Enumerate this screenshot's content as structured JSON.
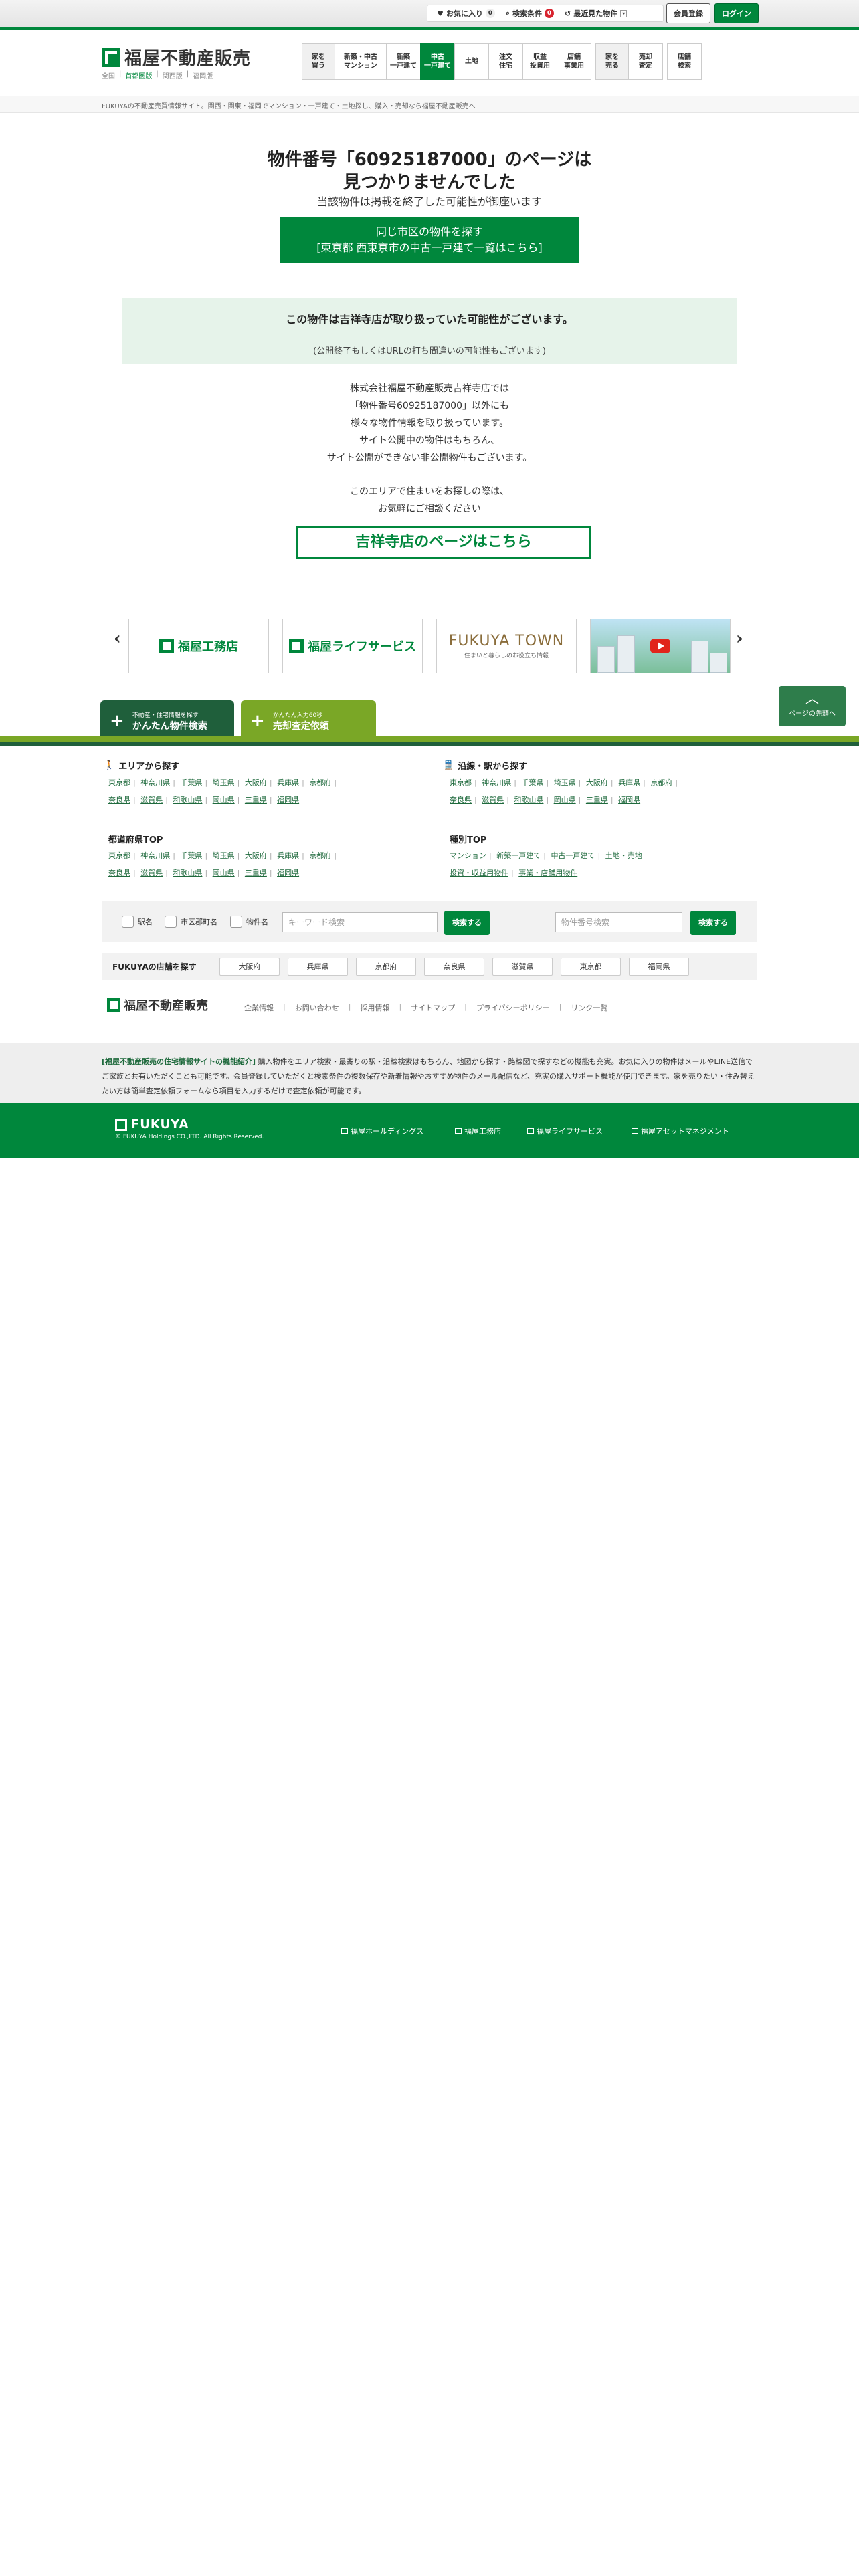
{
  "topbar": {
    "favorites_label": "お気に入り",
    "favorites_count": "0",
    "search_conditions_label": "検索条件",
    "search_conditions_count": "0",
    "recent_label": "最近見た物件",
    "register_label": "会員登録",
    "login_label": "ログイン"
  },
  "header": {
    "logo_text": "福屋不動産販売",
    "regions": [
      "全国",
      "首都圏版",
      "関西版",
      "福岡版"
    ],
    "nav": [
      {
        "label": "家を\n買う"
      },
      {
        "label": "新築・中古\nマンション"
      },
      {
        "label": "新築\n一戸建て"
      },
      {
        "label": "中古\n一戸建て"
      },
      {
        "label": "土地"
      },
      {
        "label": "注文\n住宅"
      },
      {
        "label": "収益\n投資用"
      },
      {
        "label": "店舗\n事業用"
      },
      {
        "label": "家を\n売る"
      },
      {
        "label": "売却\n査定"
      },
      {
        "label": "店舗\n検索"
      }
    ]
  },
  "breadcrumb": "FUKUYAの不動産売買情報サイト。関西・関東・福岡でマンション・一戸建て・土地探し、購入・売却なら福屋不動産販売へ",
  "main": {
    "title_line1": "物件番号「60925187000」のページは",
    "title_line2": "見つかりませんでした",
    "subtitle": "当該物件は掲載を終了した可能性が御座います",
    "city_button_line1": "同じ市区の物件を探す",
    "city_button_line2": "[東京都 西東京市の中古一戸建て一覧はこちら]",
    "notice_line1": "この物件は吉祥寺店が取り扱っていた可能性がございます。",
    "notice_line2": "(公開終了もしくはURLの打ち間違いの可能性もございます)",
    "desc_lines": [
      "株式会社福屋不動産販売吉祥寺店では",
      "「物件番号60925187000」以外にも",
      "様々な物件情報を取り扱っています。",
      "サイト公開中の物件はもちろん、",
      "サイト公開ができない非公開物件もございます。"
    ],
    "desc2_lines": [
      "このエリアで住まいをお探しの際は、",
      "お気軽にご相談ください"
    ],
    "store_button": "吉祥寺店のページはこちら"
  },
  "banners": {
    "b1": "福屋工務店",
    "b2": "福屋ライフサービス",
    "b3_title": "FUKUYA TOWN",
    "b3_sub": "住まいと暮らしのお役立ち情報",
    "prev_icon": "chevron-left-icon",
    "next_icon": "chevron-right-icon"
  },
  "pagetop_label": "ページの先頭へ",
  "footer_tabs": {
    "search_small": "不動産・住宅情報を探す",
    "search_big": "かんたん物件検索",
    "sell_small": "かんたん入力60秒",
    "sell_big": "売却査定依頼"
  },
  "footer": {
    "area_title": "エリアから探す",
    "area_row1": [
      "東京都",
      "神奈川県",
      "千葉県",
      "埼玉県",
      "大阪府",
      "兵庫県",
      "京都府"
    ],
    "area_row2": [
      "奈良県",
      "滋賀県",
      "和歌山県",
      "岡山県",
      "三重県",
      "福岡県"
    ],
    "line_title": "沿線・駅から探す",
    "line_row1": [
      "東京都",
      "神奈川県",
      "千葉県",
      "埼玉県",
      "大阪府",
      "兵庫県",
      "京都府"
    ],
    "line_row2": [
      "奈良県",
      "滋賀県",
      "和歌山県",
      "岡山県",
      "三重県",
      "福岡県"
    ],
    "pref_title": "都道府県TOP",
    "pref_row1": [
      "東京都",
      "神奈川県",
      "千葉県",
      "埼玉県",
      "大阪府",
      "兵庫県",
      "京都府"
    ],
    "pref_row2": [
      "奈良県",
      "滋賀県",
      "和歌山県",
      "岡山県",
      "三重県",
      "福岡県"
    ],
    "type_title": "種別TOP",
    "type_row1": [
      "マンション",
      "新築一戸建て",
      "中古一戸建て",
      "土地・売地"
    ],
    "type_row2": [
      "投資・収益用物件",
      "事業・店舗用物件"
    ],
    "search": {
      "chk_station": "駅名",
      "chk_city": "市区郡町名",
      "chk_property": "物件名",
      "keyword_placeholder": "キーワード検索",
      "search_button": "検索する",
      "number_placeholder": "物件番号検索",
      "number_button": "検索する"
    },
    "stores_label": "FUKUYAの店舗を探す",
    "stores": [
      "大阪府",
      "兵庫県",
      "京都府",
      "奈良県",
      "滋賀県",
      "東京都",
      "福岡県"
    ],
    "logo_text": "福屋不動産販売",
    "nav": [
      "企業情報",
      "お問い合わせ",
      "採用情報",
      "サイトマップ",
      "プライバシーポリシー",
      "リンク一覧"
    ],
    "intro_title": "[福屋不動産販売の住宅情報サイトの機能紹介]",
    "intro_text": "購入物件をエリア検索・最寄りの駅・沿線検索はもちろん、地図から探す・路線図で探すなどの機能も充実。お気に入りの物件はメールやLINE送信でご家族と共有いただくことも可能です。会員登録していただくと検索条件の複数保存や新着情報やおすすめ物件のメール配信など、充実の購入サポート機能が使用できます。家を売りたい・住み替えたい方は簡単査定依頼フォームなら項目を入力するだけで査定依頼が可能です。",
    "bottom_logo": "FUKUYA",
    "copyright": "© FUKUYA Holdings CO.,LTD. All Rights Reserved.",
    "group_links": [
      "福屋ホールディングス",
      "福屋工務店",
      "福屋ライフサービス",
      "福屋アセットマネジメント"
    ]
  },
  "colors": {
    "brand_green": "#00873c",
    "dark_green": "#1f5f3b",
    "lime": "#7aa726",
    "badge_red": "#d8242f"
  }
}
